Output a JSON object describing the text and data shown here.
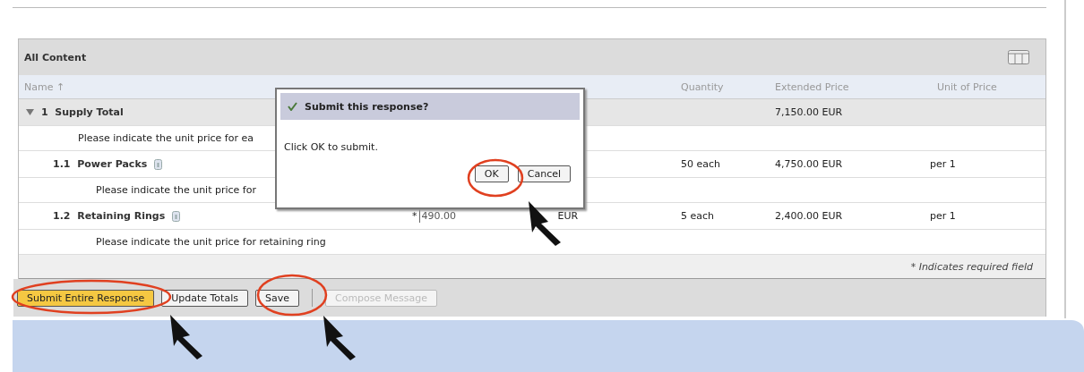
{
  "panel": {
    "title": "All Content"
  },
  "columns": {
    "name": "Name ↑",
    "quantity": "Quantity",
    "extended_price": "Extended Price",
    "unit_of_price": "Unit of Price"
  },
  "rows": [
    {
      "kind": "group",
      "number": "1",
      "name": "Supply Total",
      "expanded": true,
      "description": "Please indicate the unit price for ea",
      "extended_price": "7,150.00 EUR",
      "children": [
        {
          "kind": "item",
          "number": "1.1",
          "name": "Power Packs",
          "description": "Please indicate the unit price for",
          "quantity": "50 each",
          "extended_price": "4,750.00 EUR",
          "unit": "per 1"
        },
        {
          "kind": "item",
          "number": "1.2",
          "name": "Retaining Rings",
          "description": "Please indicate the unit price for retaining ring",
          "required_mark": "*",
          "price": "490.00",
          "currency": "EUR",
          "quantity": "5 each",
          "extended_price": "2,400.00 EUR",
          "unit": "per 1"
        }
      ]
    }
  ],
  "footnote": "* Indicates required field",
  "buttons": [
    {
      "label": "Submit Entire Response",
      "kind": "primary",
      "disabled": false
    },
    {
      "label": "Update Totals",
      "kind": "normal",
      "disabled": false
    },
    {
      "label": "Save",
      "kind": "normal",
      "disabled": false
    },
    {
      "label": "Compose Message",
      "kind": "normal",
      "disabled": true
    }
  ],
  "dialog": {
    "title": "Submit this response?",
    "message": "Click OK to submit.",
    "buttons": [
      "OK",
      "Cancel"
    ]
  }
}
